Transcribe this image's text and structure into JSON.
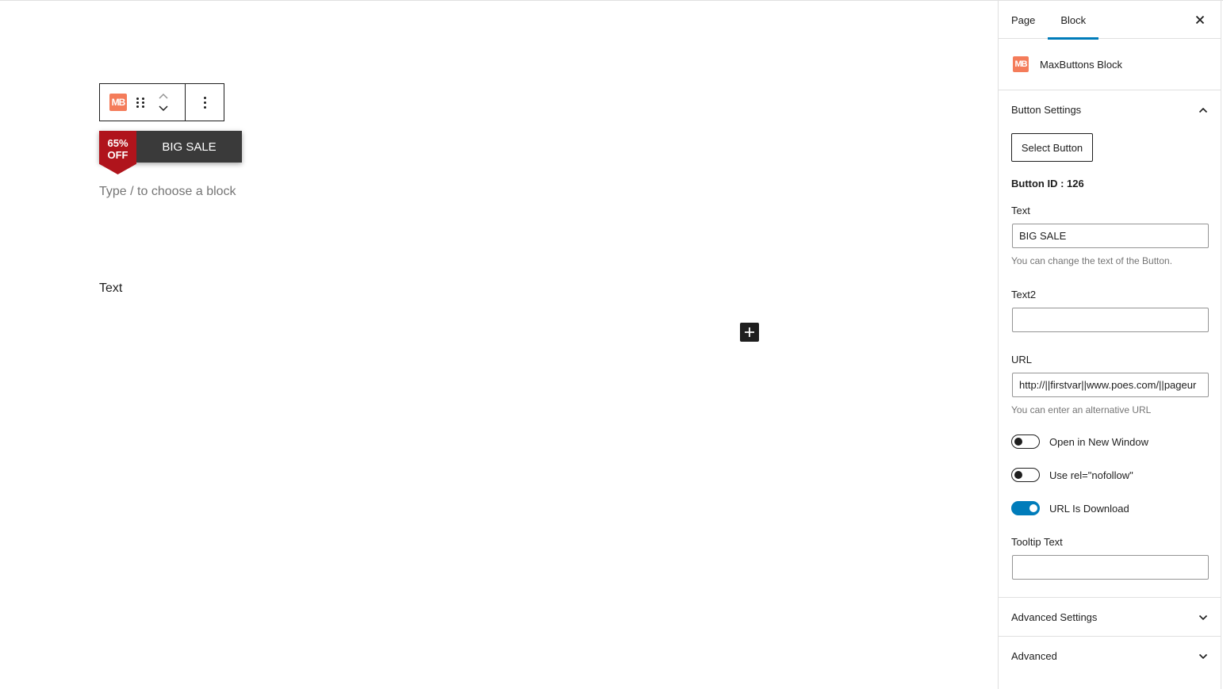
{
  "editor": {
    "sale_badge_line1": "65%",
    "sale_badge_line2": "OFF",
    "sale_button_text": "BIG SALE",
    "placeholder": "Type / to choose a block",
    "text_block": "Text",
    "toolbar": {
      "block_icon": "MB",
      "drag_icon": "drag-handle-icon",
      "move_up_icon": "chevron-up-icon",
      "move_down_icon": "chevron-down-icon",
      "options_icon": "more-vertical-icon"
    },
    "inserter_icon": "plus-icon",
    "colors": {
      "sale_tag": "#b0141c",
      "sale_body": "#3a3a3a",
      "brand": "#f47c5a"
    }
  },
  "sidebar": {
    "tabs": [
      {
        "label": "Page",
        "active": false
      },
      {
        "label": "Block",
        "active": true
      }
    ],
    "close_icon": "close-icon",
    "block_card": {
      "icon": "MB",
      "name": "MaxButtons Block"
    },
    "button_settings": {
      "title": "Button Settings",
      "select_button": "Select Button",
      "button_id": "Button ID : 126",
      "text_label": "Text",
      "text_value": "BIG SALE",
      "text_help": "You can change the text of the Button.",
      "text2_label": "Text2",
      "text2_value": "",
      "url_label": "URL",
      "url_value": "http://||firstvar||www.poes.com/||pageur",
      "url_help": "You can enter an alternative URL",
      "toggles": [
        {
          "label": "Open in New Window",
          "on": false
        },
        {
          "label": "Use rel=\"nofollow\"",
          "on": false
        },
        {
          "label": "URL Is Download",
          "on": true
        }
      ],
      "tooltip_label": "Tooltip Text",
      "tooltip_value": ""
    },
    "advanced_settings": {
      "title": "Advanced Settings"
    },
    "advanced": {
      "title": "Advanced"
    },
    "accent_color": "#007cba"
  }
}
